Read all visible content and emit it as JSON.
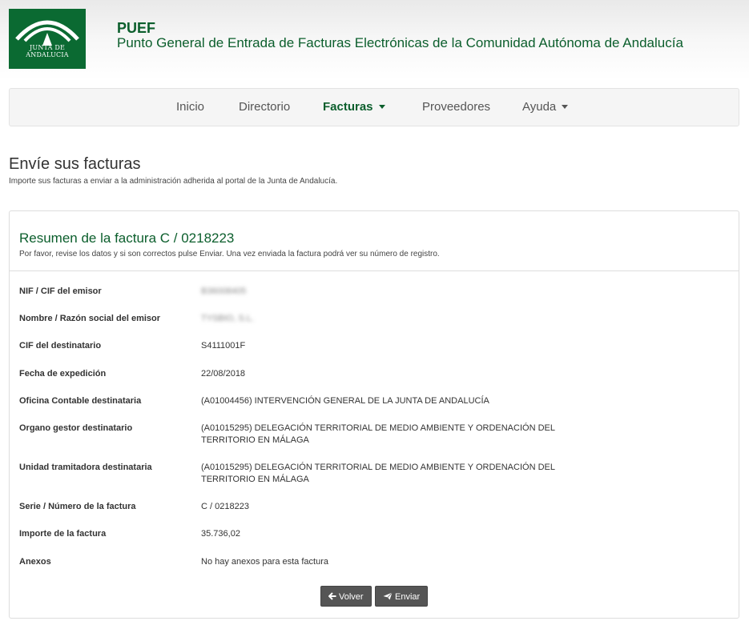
{
  "header": {
    "logo_text": "JUNTA DE ANDALUCIA",
    "app_name": "PUEF",
    "app_full_name": "Punto General de Entrada de Facturas Electrónicas de la Comunidad Autónoma de Andalucía"
  },
  "nav": {
    "items": [
      {
        "label": "Inicio",
        "active": false,
        "dropdown": false
      },
      {
        "label": "Directorio",
        "active": false,
        "dropdown": false
      },
      {
        "label": "Facturas",
        "active": true,
        "dropdown": true
      },
      {
        "label": "Proveedores",
        "active": false,
        "dropdown": false
      },
      {
        "label": "Ayuda",
        "active": false,
        "dropdown": true
      }
    ]
  },
  "page": {
    "title": "Envíe sus facturas",
    "subtitle": "Importe sus facturas a enviar a la administración adherida al portal de la Junta de Andalucía."
  },
  "summary": {
    "title": "Resumen de la factura C / 0218223",
    "note": "Por favor, revise los datos y si son correctos pulse Enviar. Una vez enviada la factura podrá ver su número de registro.",
    "rows": [
      {
        "label": "NIF / CIF del emisor",
        "value": "B36008405",
        "blurred": true
      },
      {
        "label": "Nombre / Razón social del emisor",
        "value": "TYSBIO, S.L.",
        "blurred": true
      },
      {
        "label": "CIF del destinatario",
        "value": "S4111001F"
      },
      {
        "label": "Fecha de expedición",
        "value": "22/08/2018"
      },
      {
        "label": "Oficina Contable destinataria",
        "value": "(A01004456) INTERVENCIÓN GENERAL DE LA JUNTA DE ANDALUCÍA"
      },
      {
        "label": "Organo gestor destinatario",
        "value": "(A01015295) DELEGACIÓN TERRITORIAL DE MEDIO AMBIENTE Y ORDENACIÓN DEL TERRITORIO EN MÁLAGA"
      },
      {
        "label": "Unidad tramitadora destinataria",
        "value": "(A01015295) DELEGACIÓN TERRITORIAL DE MEDIO AMBIENTE Y ORDENACIÓN DEL TERRITORIO EN MÁLAGA"
      },
      {
        "label": "Serie / Número de la factura",
        "value": "C / 0218223"
      },
      {
        "label": "Importe de la factura",
        "value": "35.736,02"
      },
      {
        "label": "Anexos",
        "value": "No hay anexos para esta factura"
      }
    ],
    "back_label": "Volver",
    "send_label": "Enviar"
  },
  "colors": {
    "brand_green": "#0b5e2c",
    "button_gray": "#555555"
  },
  "icons": {
    "back": "arrow-left-icon",
    "send": "paper-plane-icon"
  }
}
